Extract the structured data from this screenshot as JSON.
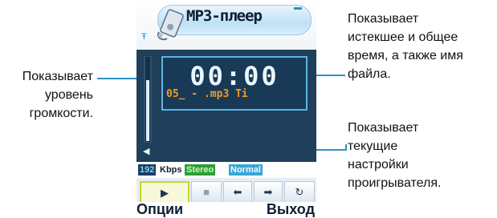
{
  "phone": {
    "title": "МР3-плеер",
    "time": "00:00",
    "file_name": "05_ - .mp3  Ti",
    "bitrate_value": "192",
    "bitrate_unit": "Kbps",
    "channel_mode": "Stereo",
    "eq_mode": "Normal",
    "softkey_left": "Опции",
    "softkey_right": "Выход",
    "controls": [
      {
        "icon": "play-icon",
        "glyph": "▶"
      },
      {
        "icon": "stop-icon",
        "glyph": "■"
      },
      {
        "icon": "previous-icon",
        "glyph": "⬅"
      },
      {
        "icon": "next-icon",
        "glyph": "➡"
      },
      {
        "icon": "repeat-icon",
        "glyph": "↻"
      }
    ]
  },
  "callouts": {
    "volume": [
      "Показывает",
      "уровень",
      "громкости."
    ],
    "time": [
      "Показывает",
      "истекшее и общее",
      "время, а также имя",
      "файла."
    ],
    "settings": [
      "Показывает",
      "текущие",
      "настройки",
      "проигрывателя."
    ]
  },
  "colors": {
    "leader_line": "#2e8fc4",
    "screen_bg": "#1f3f5b",
    "file_name": "#f39a21",
    "stereo_badge": "#2e9d3c",
    "normal_badge": "#3aa6d6"
  }
}
